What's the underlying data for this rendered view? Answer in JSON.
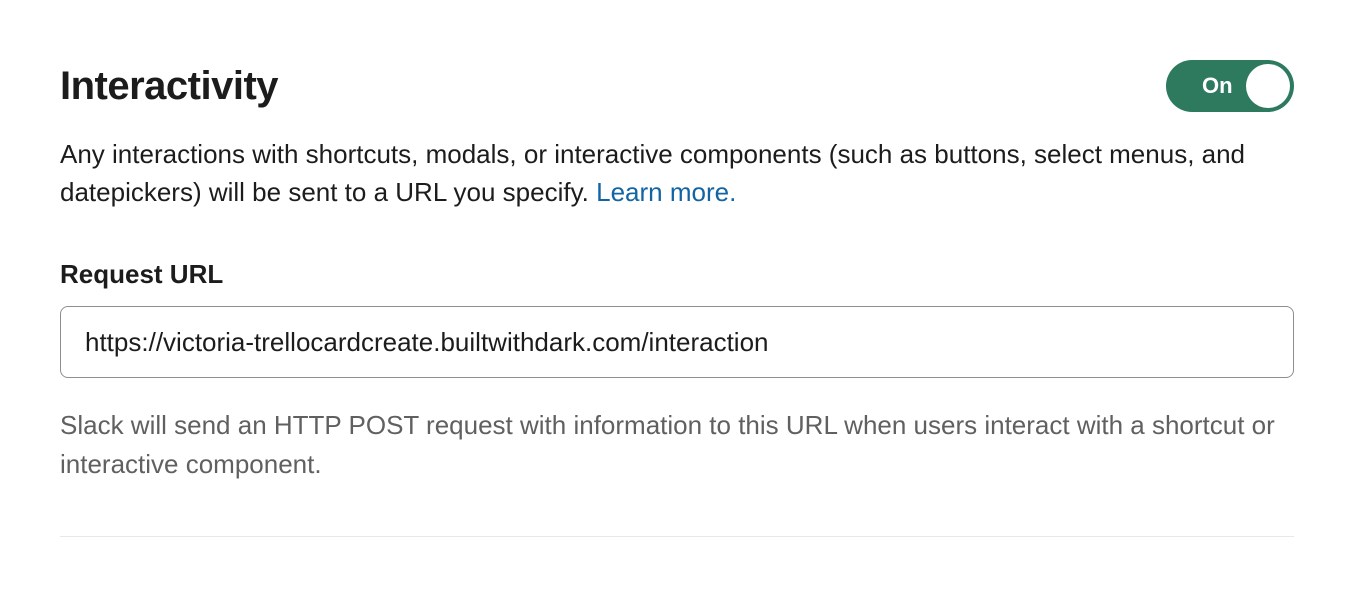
{
  "section": {
    "title": "Interactivity",
    "description": "Any interactions with shortcuts, modals, or interactive components (such as buttons, select menus, and datepickers) will be sent to a URL you specify. ",
    "learn_more": "Learn more."
  },
  "toggle": {
    "state": "On"
  },
  "request_url": {
    "label": "Request URL",
    "value": "https://victoria-trellocardcreate.builtwithdark.com/interaction",
    "helper": "Slack will send an HTTP POST request with information to this URL when users interact with a shortcut or interactive component."
  }
}
